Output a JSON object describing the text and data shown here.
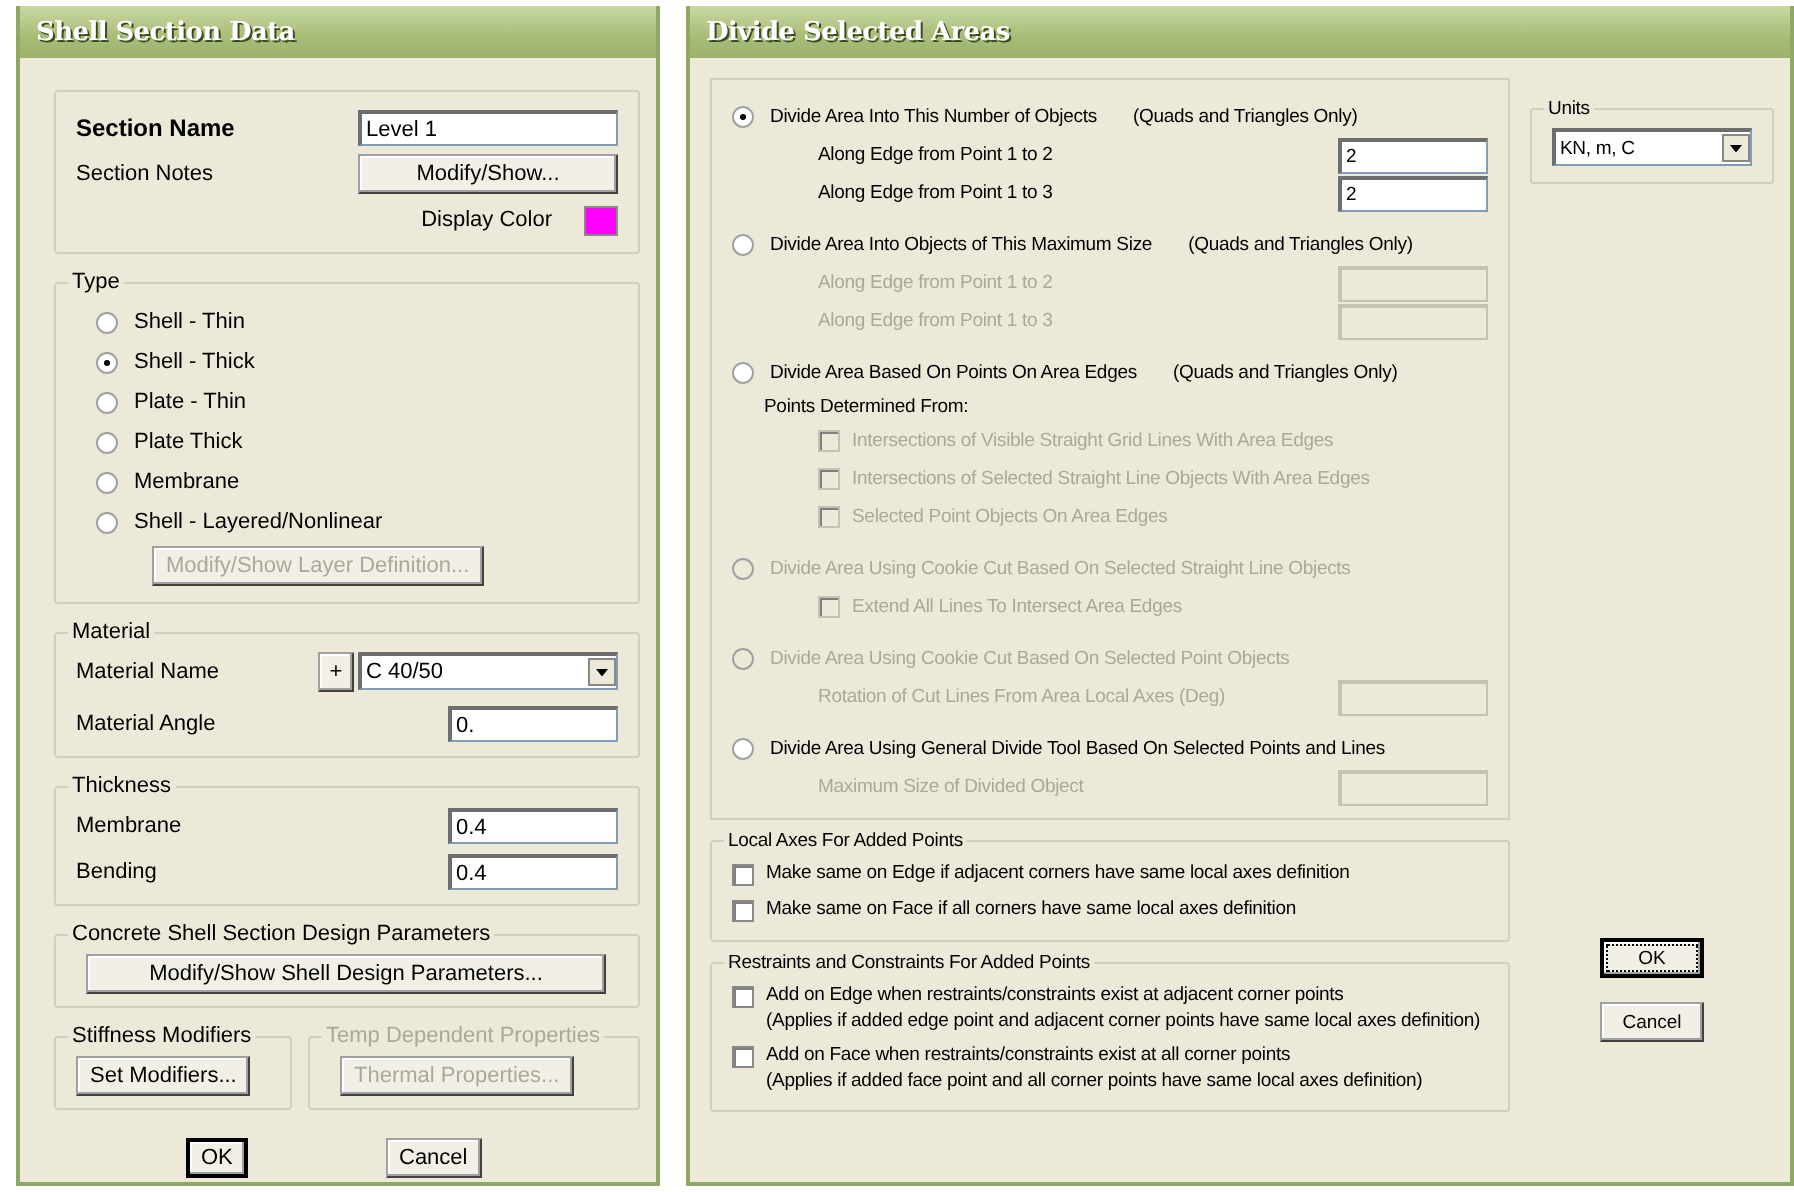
{
  "shell_dialog": {
    "title": "Shell Section Data",
    "section_name": {
      "label": "Section Name",
      "value": "Level 1"
    },
    "section_notes": {
      "label": "Section Notes",
      "button": "Modify/Show..."
    },
    "display_color": {
      "label": "Display Color",
      "color": "#ff00ff"
    },
    "type": {
      "legend": "Type",
      "options": [
        {
          "label": "Shell - Thin",
          "selected": false
        },
        {
          "label": "Shell - Thick",
          "selected": true
        },
        {
          "label": "Plate - Thin",
          "selected": false
        },
        {
          "label": "Plate Thick",
          "selected": false
        },
        {
          "label": "Membrane",
          "selected": false
        },
        {
          "label": "Shell - Layered/Nonlinear",
          "selected": false
        }
      ],
      "layer_button": {
        "label": "Modify/Show Layer Definition...",
        "disabled": true
      }
    },
    "material": {
      "legend": "Material",
      "name_label": "Material Name",
      "add_button": "+",
      "name_value": "C 40/50",
      "angle_label": "Material Angle",
      "angle_value": "0."
    },
    "thickness": {
      "legend": "Thickness",
      "fields": [
        {
          "label": "Membrane",
          "value": "0.4"
        },
        {
          "label": "Bending",
          "value": "0.4"
        }
      ]
    },
    "design": {
      "legend": "Concrete Shell Section Design Parameters",
      "button": "Modify/Show Shell Design Parameters..."
    },
    "stiffness": {
      "legend": "Stiffness Modifiers",
      "button": "Set Modifiers...",
      "disabled": false
    },
    "temp": {
      "legend": "Temp Dependent Properties",
      "button": "Thermal Properties...",
      "disabled": true
    },
    "buttons": [
      {
        "label": "OK",
        "default": true
      },
      {
        "label": "Cancel",
        "default": false
      }
    ]
  },
  "divide_dialog": {
    "title": "Divide Selected Areas",
    "options": [
      {
        "label": "Divide Area Into This Number of Objects",
        "note": "(Quads and Triangles Only)",
        "selected": true,
        "disabled": false,
        "fields": [
          {
            "label": "Along Edge from Point 1 to 2",
            "value": "2",
            "disabled": false
          },
          {
            "label": "Along Edge from Point 1 to 3",
            "value": "2",
            "disabled": false
          }
        ]
      },
      {
        "label": "Divide Area Into Objects of This Maximum Size",
        "note": "(Quads and Triangles Only)",
        "selected": false,
        "disabled": false,
        "fields": [
          {
            "label": "Along Edge from Point 1 to 2",
            "disabled": true
          },
          {
            "label": "Along Edge from Point 1 to 3",
            "disabled": true
          }
        ]
      },
      {
        "label": "Divide Area Based On Points On Area Edges",
        "note": "(Quads and Triangles Only)",
        "selected": false,
        "disabled": false,
        "sublabel": "Points Determined From:",
        "checkboxes": [
          {
            "label": "Intersections of Visible Straight Grid Lines With Area Edges",
            "checked": false,
            "disabled": true
          },
          {
            "label": "Intersections of Selected Straight Line Objects With Area Edges",
            "checked": false,
            "disabled": true
          },
          {
            "label": "Selected Point Objects On Area Edges",
            "checked": false,
            "disabled": true
          }
        ]
      },
      {
        "label": "Divide Area Using Cookie Cut Based On Selected Straight Line Objects",
        "selected": false,
        "disabled": true,
        "checkboxes": [
          {
            "label": "Extend All Lines To Intersect Area Edges",
            "checked": false,
            "disabled": true
          }
        ]
      },
      {
        "label": "Divide Area Using Cookie Cut Based On Selected Point Objects",
        "selected": false,
        "disabled": true,
        "fields": [
          {
            "label": "Rotation of Cut Lines From Area Local Axes (Deg)",
            "disabled": true
          }
        ]
      },
      {
        "label": "Divide Area Using General Divide Tool Based On Selected Points and Lines",
        "selected": false,
        "disabled": false,
        "fields": [
          {
            "label": "Maximum Size of Divided Object",
            "disabled": true
          }
        ]
      }
    ],
    "local_axes": {
      "legend": "Local Axes For Added Points",
      "checkboxes": [
        {
          "label": "Make same on Edge if adjacent corners have same local axes definition",
          "checked": false
        },
        {
          "label": "Make same on Face if all corners have same local axes definition",
          "checked": false
        }
      ]
    },
    "restraints": {
      "legend": "Restraints and Constraints For Added Points",
      "checkboxes": [
        {
          "label": "Add on Edge when restraints/constraints exist at adjacent corner points",
          "note": "(Applies if added edge point and adjacent corner points have same local axes definition)",
          "checked": false
        },
        {
          "label": "Add on Face when restraints/constraints exist at all corner points",
          "note": "(Applies if added face point and all corner points have same local axes definition)",
          "checked": false
        }
      ]
    },
    "units": {
      "legend": "Units",
      "value": "KN, m, C"
    },
    "buttons": [
      {
        "label": "OK",
        "default": true,
        "focused": true
      },
      {
        "label": "Cancel",
        "default": false,
        "focused": false
      }
    ]
  }
}
